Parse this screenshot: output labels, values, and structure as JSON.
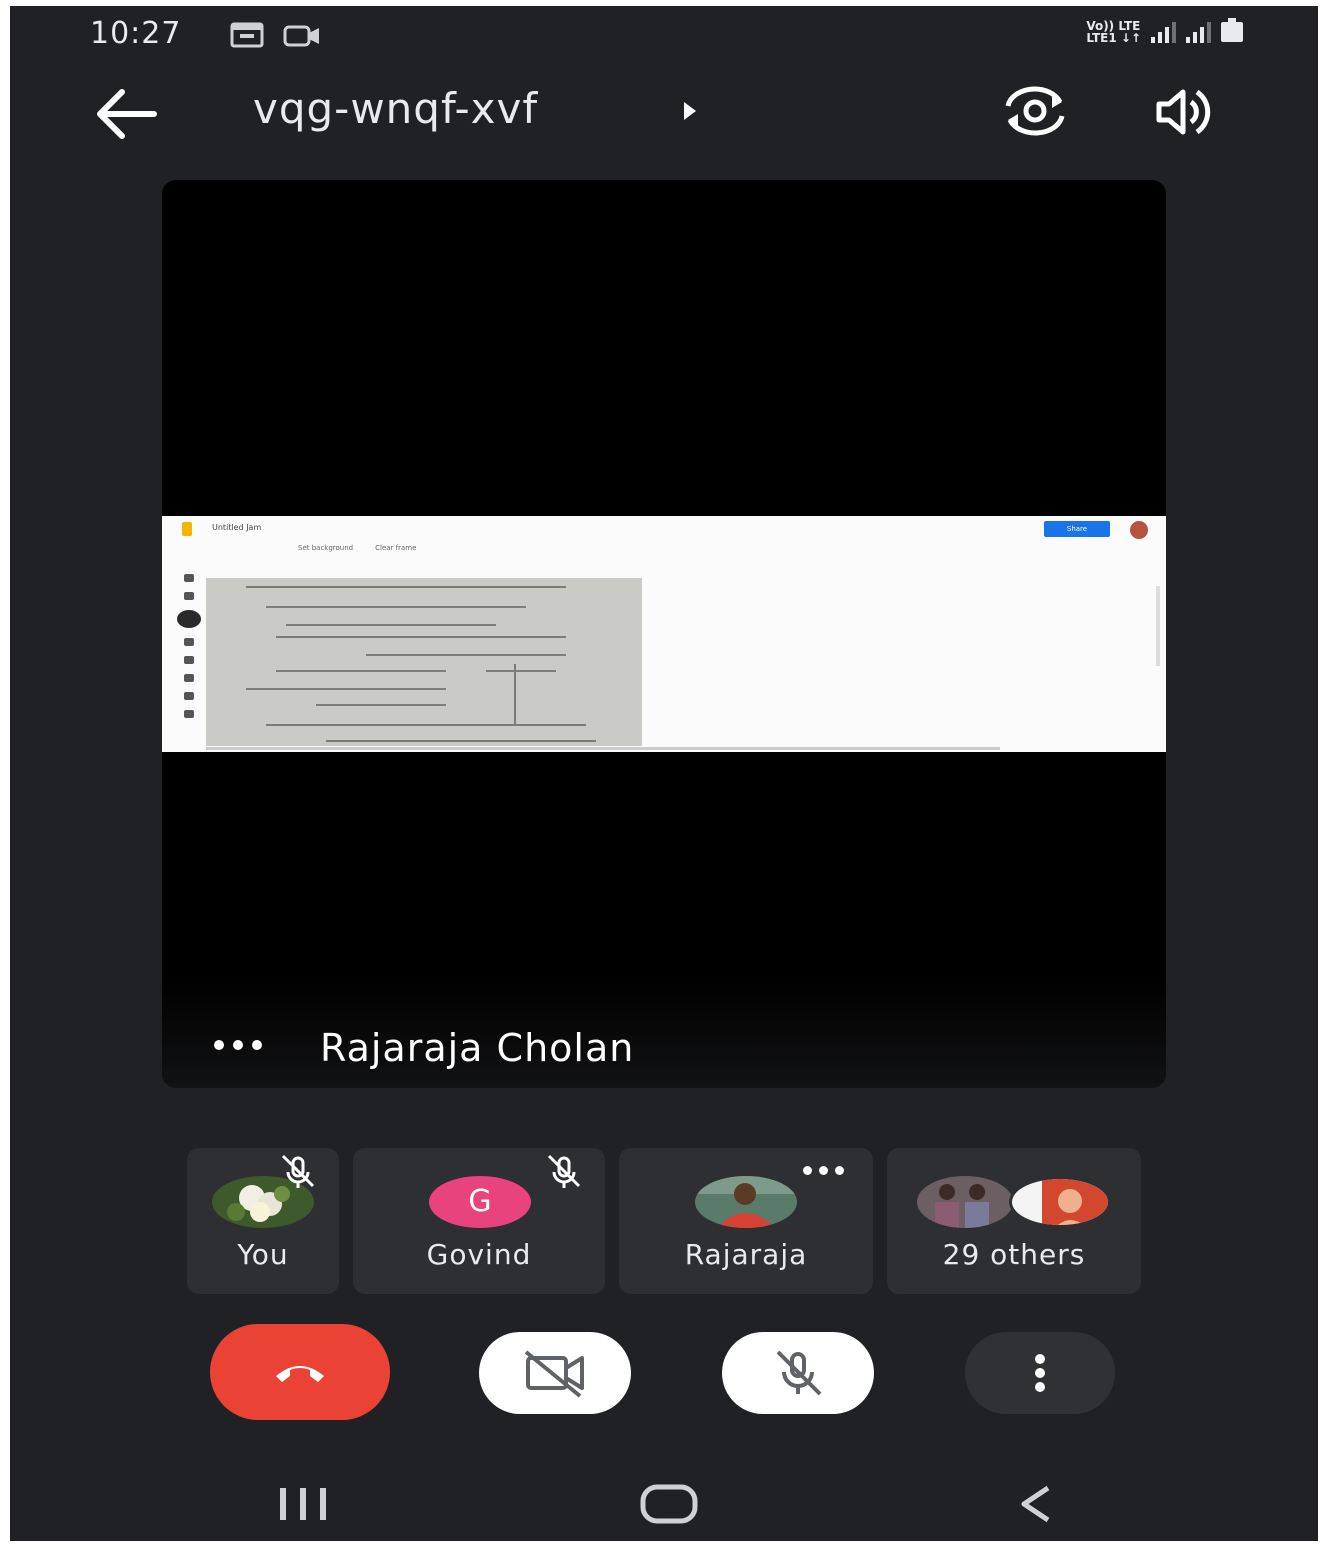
{
  "status_bar": {
    "time": "10:27",
    "network_top": "Vo)) LTE",
    "network_bottom": "LTE1 ↓↑"
  },
  "header": {
    "meeting_code": "vqg-wnqf-xvf",
    "icons": [
      "back-arrow-icon",
      "caret-right-icon",
      "switch-camera-icon",
      "speaker-icon"
    ]
  },
  "main_tile": {
    "presenter_name": "Rajaraja Cholan",
    "shared_screen": {
      "doc_title": "Untitled Jam",
      "toolbar_items": [
        "Set background",
        "Clear frame"
      ],
      "share_label": "Share"
    }
  },
  "participants": [
    {
      "name": "You",
      "muted": true
    },
    {
      "name": "Govind",
      "initial": "G",
      "muted": true,
      "avatar_color": "#e8437c"
    },
    {
      "name": "Rajaraja",
      "muted": false
    },
    {
      "name": "29 others"
    }
  ],
  "controls": {
    "end_call_color": "#ea4335",
    "icons": [
      "end-call-icon",
      "camera-off-icon",
      "mic-off-icon",
      "more-options-icon"
    ]
  },
  "nav_bar": {
    "icons": [
      "recents-icon",
      "home-icon",
      "back-icon"
    ]
  }
}
